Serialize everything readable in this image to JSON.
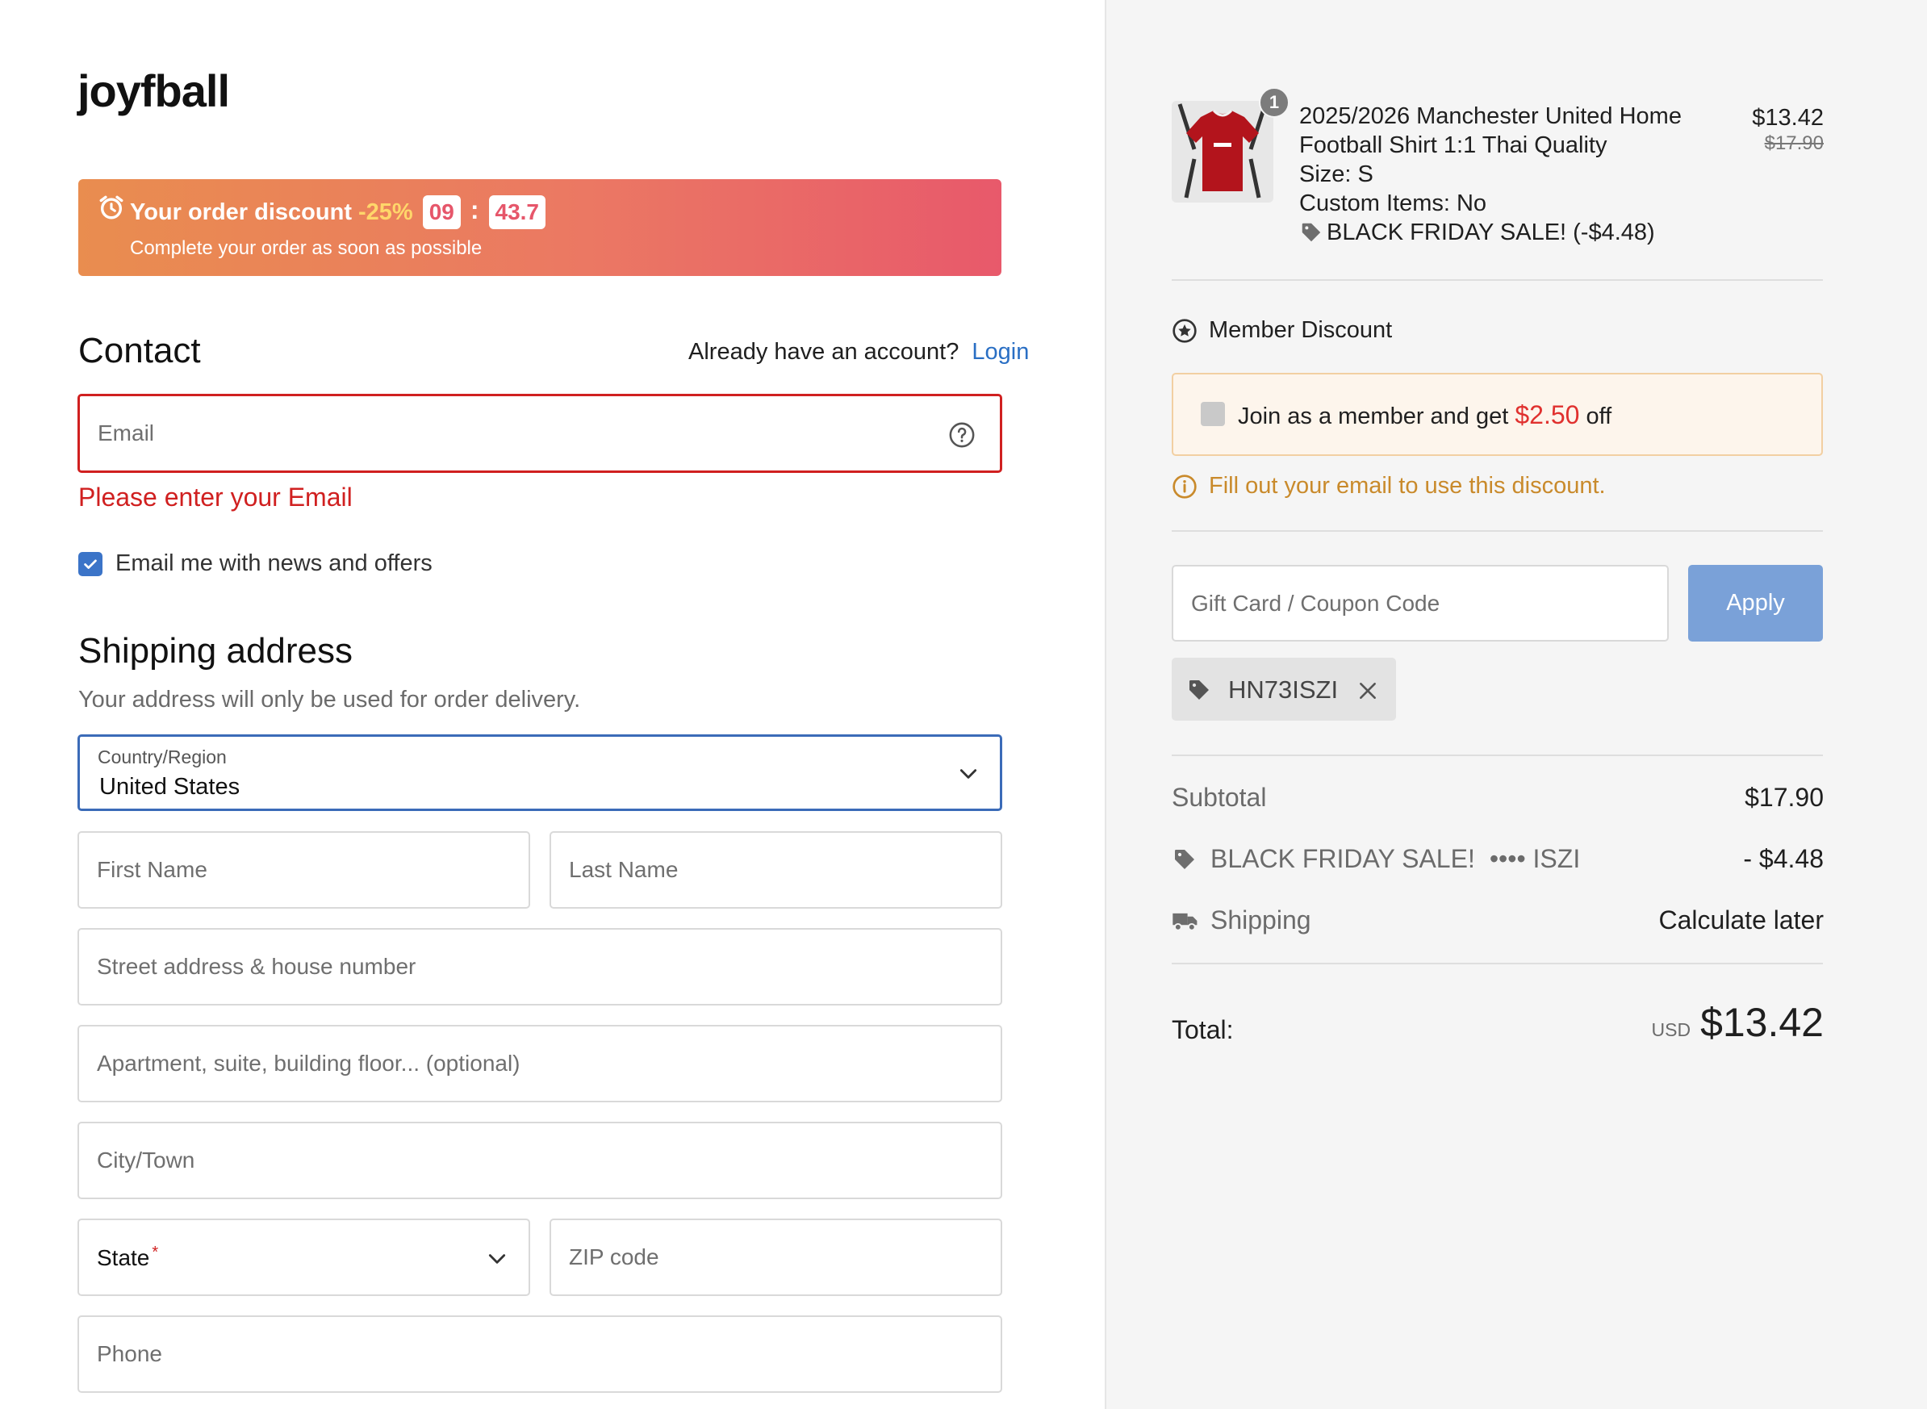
{
  "brand": "joyfball",
  "discount": {
    "label": "Your order discount",
    "percent": "-25%",
    "minutes": "09",
    "seconds": "43.7",
    "subtext": "Complete your order as soon as possible"
  },
  "contact": {
    "title": "Contact",
    "account_prompt": "Already have an account?",
    "login_label": "Login",
    "email_placeholder": "Email",
    "email_error": "Please enter your Email",
    "newsletter_label": "Email me with news and offers",
    "newsletter_checked": true
  },
  "shipping": {
    "title": "Shipping address",
    "subtitle": "Your address will only be used for order delivery.",
    "country_label": "Country/Region",
    "country_value": "United States",
    "first_name_placeholder": "First Name",
    "last_name_placeholder": "Last Name",
    "street_placeholder": "Street address & house number",
    "apartment_placeholder": "Apartment, suite, building floor... (optional)",
    "city_placeholder": "City/Town",
    "state_label": "State",
    "state_required_mark": "*",
    "zip_placeholder": "ZIP code",
    "phone_placeholder": "Phone"
  },
  "order": {
    "item": {
      "quantity": "1",
      "name_line1": "2025/2026 Manchester United Home",
      "name_line2": "Football Shirt 1:1 Thai Quality",
      "size": "Size: S",
      "custom": "Custom Items: No",
      "promo": "BLACK FRIDAY SALE! (-$4.48)",
      "price": "$13.42",
      "original_price": "$17.90"
    },
    "member": {
      "title": "Member Discount",
      "join_text": "Join as a member and get",
      "join_amount": "$2.50",
      "join_suffix": "off",
      "notice": "Fill out your email to use this discount."
    },
    "coupon": {
      "placeholder": "Gift Card / Coupon Code",
      "apply_label": "Apply",
      "applied_code": "HN73ISZI"
    },
    "summary": {
      "subtotal_label": "Subtotal",
      "subtotal_value": "$17.90",
      "discount_label": "BLACK FRIDAY SALE!",
      "discount_code": "•••• ISZI",
      "discount_value": "- $4.48",
      "shipping_label": "Shipping",
      "shipping_value": "Calculate later",
      "total_label": "Total:",
      "currency": "USD",
      "total_value": "$13.42"
    }
  },
  "colors": {
    "error": "#d02020",
    "link": "#2a6fc4",
    "accent_blue": "#3b74c8",
    "member_amount": "#e0312f",
    "notice": "#c98a2b"
  }
}
